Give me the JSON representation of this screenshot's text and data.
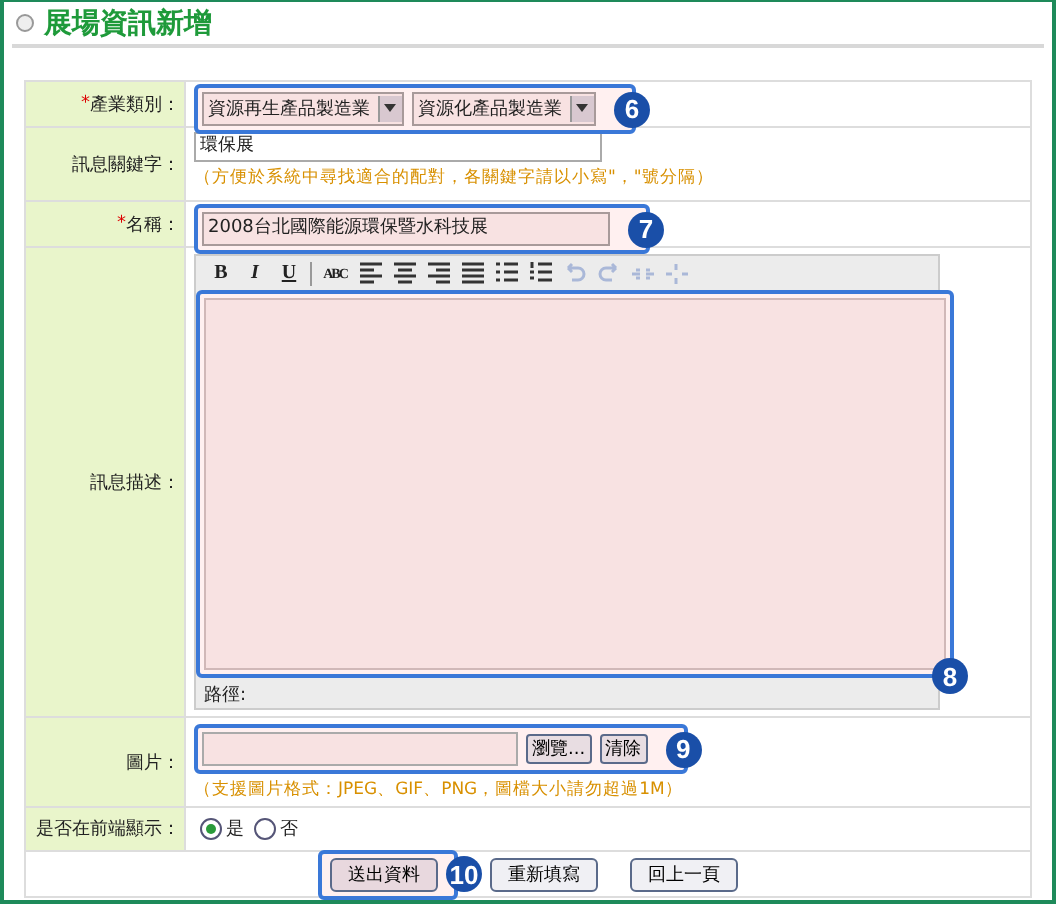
{
  "page_title": "展場資訊新增",
  "form": {
    "rows": [
      {
        "kind": "selects",
        "mark": "*",
        "label": "產業類別：",
        "callout": "6",
        "selects": [
          {
            "value": "資源再生產品製造業"
          },
          {
            "value": "資源化產品製造業"
          }
        ]
      },
      {
        "kind": "keywords",
        "label": "訊息關鍵字：",
        "value": "環保展",
        "hint": "（方便於系統中尋找適合的配對，各關鍵字請以小寫\"，\"號分隔）"
      },
      {
        "kind": "text",
        "mark": "*",
        "label": "名稱：",
        "callout": "7",
        "value": "2008台北國際能源環保暨水科技展"
      },
      {
        "kind": "editor",
        "label": "訊息描述：",
        "callout": "8",
        "path_label": "路徑:",
        "toolbar": [
          {
            "kind": "bold",
            "label": "B",
            "disabled": false
          },
          {
            "kind": "italic",
            "label": "I",
            "disabled": false
          },
          {
            "kind": "underline",
            "label": "U",
            "disabled": false
          },
          {
            "kind": "separator"
          },
          {
            "kind": "spellcheck",
            "label": "ABC",
            "disabled": false
          },
          {
            "kind": "alignleft",
            "disabled": false
          },
          {
            "kind": "aligncenter",
            "disabled": false
          },
          {
            "kind": "alignright",
            "disabled": false
          },
          {
            "kind": "justify",
            "disabled": false
          },
          {
            "kind": "bullets",
            "disabled": false
          },
          {
            "kind": "numbering",
            "disabled": false
          },
          {
            "kind": "undo",
            "disabled": true
          },
          {
            "kind": "redo",
            "disabled": true
          },
          {
            "kind": "link",
            "disabled": true
          },
          {
            "kind": "unlink",
            "disabled": true
          }
        ]
      },
      {
        "kind": "file",
        "label": "圖片：",
        "callout": "9",
        "browse": "瀏覽...",
        "clear": "清除",
        "hint": "（支援圖片格式：JPEG、GIF、PNG，圖檔大小請勿超過1M）"
      },
      {
        "kind": "radios",
        "label": "是否在前端顯示：",
        "options": [
          {
            "label": "是",
            "selected": true
          },
          {
            "label": "否",
            "selected": false
          }
        ]
      }
    ],
    "buttons": [
      {
        "label": "送出資料",
        "focused": true,
        "callout": "10"
      },
      {
        "label": "重新填寫",
        "focused": false
      },
      {
        "label": "回上一頁",
        "focused": false
      }
    ]
  }
}
